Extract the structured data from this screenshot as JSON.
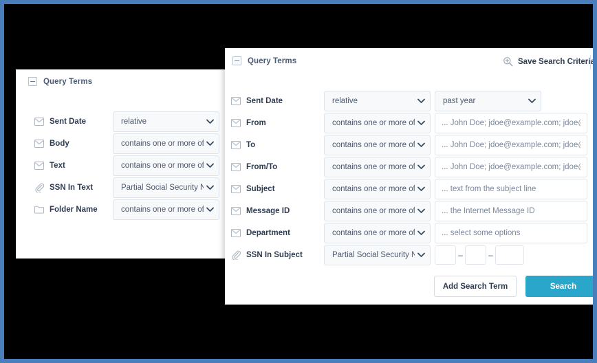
{
  "theme": {
    "frame_border": "#4a7ebb",
    "backdrop": "#000000",
    "panel_bg": "#ffffff",
    "primary_button": "#2ba6cb",
    "label_color": "#2f3c50",
    "title_color": "#4a5b73"
  },
  "background_panel": {
    "header": {
      "title": "Query Terms",
      "collapse_icon": "minus-square-icon"
    },
    "rows": [
      {
        "icon": "envelope-icon",
        "label": "Sent Date",
        "select": "relative"
      },
      {
        "icon": "envelope-icon",
        "label": "Body",
        "select": "contains one or more of"
      },
      {
        "icon": "envelope-icon",
        "label": "Text",
        "select": "contains one or more of"
      },
      {
        "icon": "paperclip-icon",
        "label": "SSN In Text",
        "select": "Partial Social Security Numb"
      },
      {
        "icon": "folder-icon",
        "label": "Folder Name",
        "select": "contains one or more of"
      }
    ]
  },
  "foreground_panel": {
    "header": {
      "title": "Query Terms",
      "collapse_icon": "minus-square-icon",
      "save_search_label": "Save Search Criteria",
      "save_search_icon": "search-plus-icon"
    },
    "rows": [
      {
        "icon": "envelope-icon",
        "label": "Sent Date",
        "select": "relative",
        "second_select": "past year",
        "kind": "two-selects"
      },
      {
        "icon": "envelope-icon",
        "label": "From",
        "select": "contains one or more of",
        "placeholder": "... John Doe; jdoe@example.com; jdoe@*; '@example",
        "kind": "select-input"
      },
      {
        "icon": "envelope-icon",
        "label": "To",
        "select": "contains one or more of",
        "placeholder": "... John Doe; jdoe@example.com; jdoe@*; '@example",
        "kind": "select-input"
      },
      {
        "icon": "envelope-icon",
        "label": "From/To",
        "select": "contains one or more of",
        "placeholder": "... John Doe; jdoe@example.com; jdoe@*; '@example",
        "kind": "select-input"
      },
      {
        "icon": "envelope-icon",
        "label": "Subject",
        "select": "contains one or more of",
        "placeholder": "... text from the subject line",
        "kind": "select-input"
      },
      {
        "icon": "envelope-icon",
        "label": "Message ID",
        "select": "contains one or more of",
        "placeholder": "... the Internet Message ID",
        "kind": "select-input"
      },
      {
        "icon": "envelope-icon",
        "label": "Department",
        "select": "contains one or more of",
        "placeholder": "... select some options",
        "kind": "select-input"
      },
      {
        "icon": "paperclip-icon",
        "label": "SSN In Subject",
        "select": "Partial Social Security Numb",
        "kind": "ssn",
        "ssn": {
          "part1": "",
          "part2": "",
          "part3": "",
          "separator": "–"
        }
      }
    ],
    "footer": {
      "add_search_term_label": "Add Search Term",
      "search_label": "Search"
    }
  }
}
